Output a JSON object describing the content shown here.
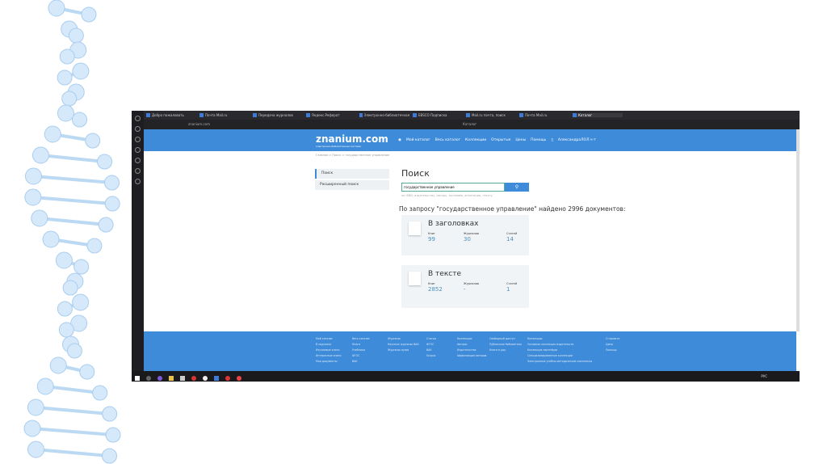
{
  "browser": {
    "tabs": [
      "Добро пожаловать",
      "Почта Mail.ru",
      "Передача журналов",
      "Яндекс.Реферат",
      "Электронно-библиотечная",
      "EBSCO Подписка",
      "Mail.ru почта, поиск",
      "Почта Mail.ru",
      "Каталог"
    ],
    "url": "znanium.com",
    "page_title": "Каталог"
  },
  "site": {
    "logo": "znanium.com",
    "tagline": "электронно-библиотечная система",
    "nav": [
      "Мой каталог",
      "Весь каталог",
      "Коллекции",
      "Открытые",
      "Цены",
      "Помощь"
    ],
    "user": "АлександраЛОЛ.ч-т",
    "breadcrumbs": "Главная  >  Поиск  >  государственное управление"
  },
  "menu": [
    "Поиск",
    "Расширенный поиск"
  ],
  "search": {
    "title": "Поиск",
    "value": "государственное управление",
    "button_icon": "search-icon",
    "hint": "по ISBN, издательству, автору, заглавию, аннотации, тексту"
  },
  "result_text": "По запросу \"государственное управление\" найдено 2996 документов:",
  "cards": [
    {
      "title": "В заголовках",
      "books_label": "Книг",
      "books": "99",
      "journals_label": "Журналов",
      "journals": "30",
      "articles_label": "Статей",
      "articles": "14"
    },
    {
      "title": "В тексте",
      "books_label": "Книг",
      "books": "2852",
      "journals_label": "Журналов",
      "journals": "-",
      "articles_label": "Статей",
      "articles": "1"
    }
  ],
  "footer": {
    "cols": [
      [
        "Мой каталог",
        "В подписке",
        "Изучаемые книги",
        "Интересные книги",
        "Мои документы"
      ],
      [
        "Весь каталог",
        "Книги",
        "Учебники",
        "ФГОС",
        "ВАК"
      ],
      [
        "Журналы",
        "Научные журналы ВАК",
        "Журналы вузов"
      ],
      [
        "Статьи",
        "ФГОС",
        "ВАК",
        "Scopus"
      ],
      [
        "Коллекции",
        "Авторы",
        "Издательства",
        "Аффилиация авторов"
      ],
      [
        "Свободный доступ",
        "Публичные библиотеки",
        "Книги в дар"
      ],
      [
        "Коллекции",
        "Основная коллекция издательств",
        "Коллекция партнёров",
        "Специализированные коллекции",
        "Электронные учебно-методические комплексы"
      ],
      [
        "О проекте",
        "Цены",
        "Помощь"
      ]
    ]
  },
  "taskbar": {
    "clock": "РУС"
  },
  "colors": {
    "brand": "#3d8bd9",
    "card_bg": "#f1f4f7",
    "link": "#4a8fc0",
    "dna": "#a9cdf0"
  }
}
